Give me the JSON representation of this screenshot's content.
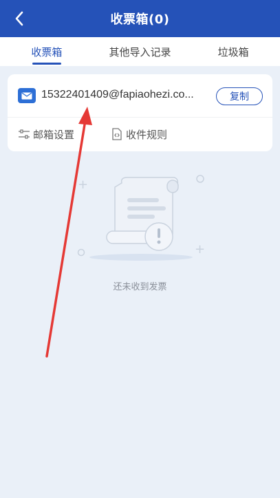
{
  "header": {
    "title": "收票箱(0)"
  },
  "tabs": [
    {
      "label": "收票箱",
      "active": true
    },
    {
      "label": "其他导入记录",
      "active": false
    },
    {
      "label": "垃圾箱",
      "active": false
    }
  ],
  "mailbox": {
    "email": "15322401409@fapiaohezi.co...",
    "copy_label": "复制"
  },
  "settings": {
    "mail_settings_label": "邮箱设置",
    "receive_rules_label": "收件规则"
  },
  "empty_state": {
    "text": "还未收到发票"
  },
  "colors": {
    "primary": "#2552b8",
    "background": "#eaf0f8",
    "annotation_arrow": "#e53935"
  },
  "icons": [
    "back-arrow-icon",
    "mail-icon",
    "sliders-icon",
    "code-file-icon",
    "empty-receipt-icon"
  ]
}
